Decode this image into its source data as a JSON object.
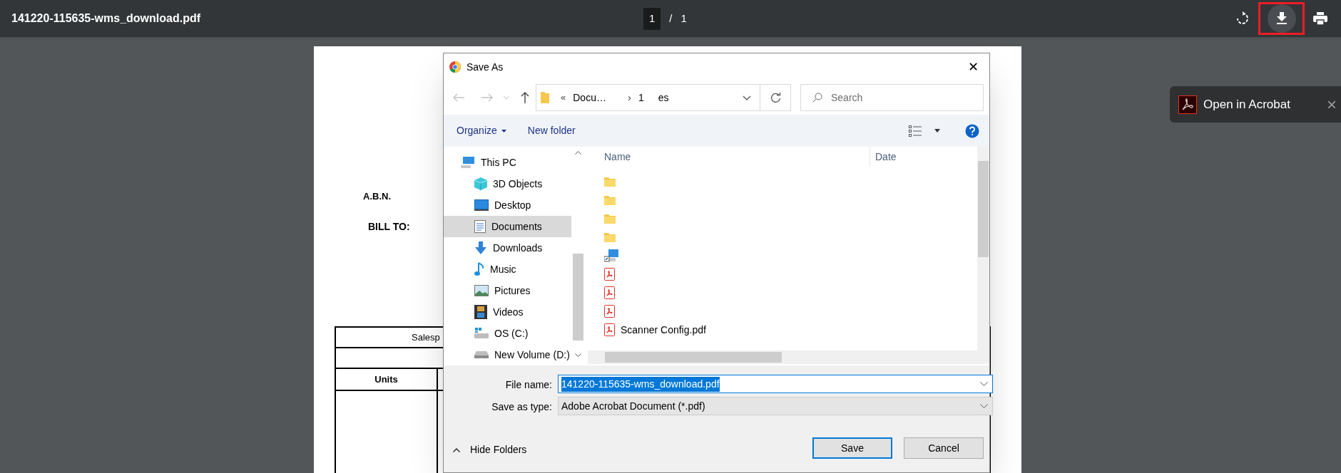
{
  "viewer": {
    "file_name": "141220-115635-wms_download.pdf",
    "page_current": "1",
    "separator": "/",
    "page_total": "1"
  },
  "toolbar_buttons": [
    {
      "kind": "rotate",
      "highlighted": false
    },
    {
      "kind": "download",
      "highlighted": true
    },
    {
      "kind": "print",
      "highlighted": false
    }
  ],
  "document": {
    "abn_label": "A.B.N.",
    "bill_to": "BILL TO:",
    "table_title": "Salesp",
    "units_header": "Units"
  },
  "acrobat_popup": {
    "label": "Open in Acrobat",
    "close": "×"
  },
  "dialog": {
    "title": "Save As",
    "close": "✕",
    "breadcrumb": [
      {
        "kind": "chevrons",
        "text": "«"
      },
      {
        "kind": "crumb",
        "text": "Docu…"
      },
      {
        "kind": "separator",
        "text": "›"
      },
      {
        "kind": "crumb",
        "text": "1"
      },
      {
        "kind": "crumb",
        "text": "es"
      }
    ],
    "search_placeholder": "Search",
    "organize": "Organize",
    "new_folder": "New folder",
    "nav_items": [
      {
        "label": "This PC",
        "kind": "pc",
        "selected": false,
        "children": [
          {
            "label": "3D Objects",
            "kind": "cube",
            "selected": false
          },
          {
            "label": "Desktop",
            "kind": "desktop",
            "selected": false
          },
          {
            "label": "Documents",
            "kind": "documents",
            "selected": true
          },
          {
            "label": "Downloads",
            "kind": "downloads",
            "selected": false
          },
          {
            "label": "Music",
            "kind": "music",
            "selected": false
          },
          {
            "label": "Pictures",
            "kind": "pictures",
            "selected": false
          },
          {
            "label": "Videos",
            "kind": "videos",
            "selected": false
          },
          {
            "label": "OS (C:)",
            "kind": "drive_c",
            "selected": false
          },
          {
            "label": "New Volume (D:)",
            "kind": "drive_d",
            "selected": false
          }
        ]
      }
    ],
    "columns": [
      "Name",
      "Date"
    ],
    "files": [
      {
        "kind": "folder"
      },
      {
        "kind": "folder"
      },
      {
        "kind": "folder"
      },
      {
        "kind": "folder"
      },
      {
        "kind": "shortcut"
      },
      {
        "kind": "pdf"
      },
      {
        "kind": "pdf"
      },
      {
        "kind": "pdf"
      },
      {
        "kind": "pdf",
        "name": "Scanner Config.pdf"
      }
    ],
    "file_name_label": "File name:",
    "file_name": "141220-115635-wms_download.pdf",
    "file_name_selected": true,
    "save_type_label": "Save as type:",
    "save_type": "Adobe Acrobat Document (*.pdf)",
    "hide_folders": "Hide Folders",
    "buttons": [
      {
        "label": "Save",
        "default": true
      },
      {
        "label": "Cancel",
        "default": false
      }
    ]
  }
}
